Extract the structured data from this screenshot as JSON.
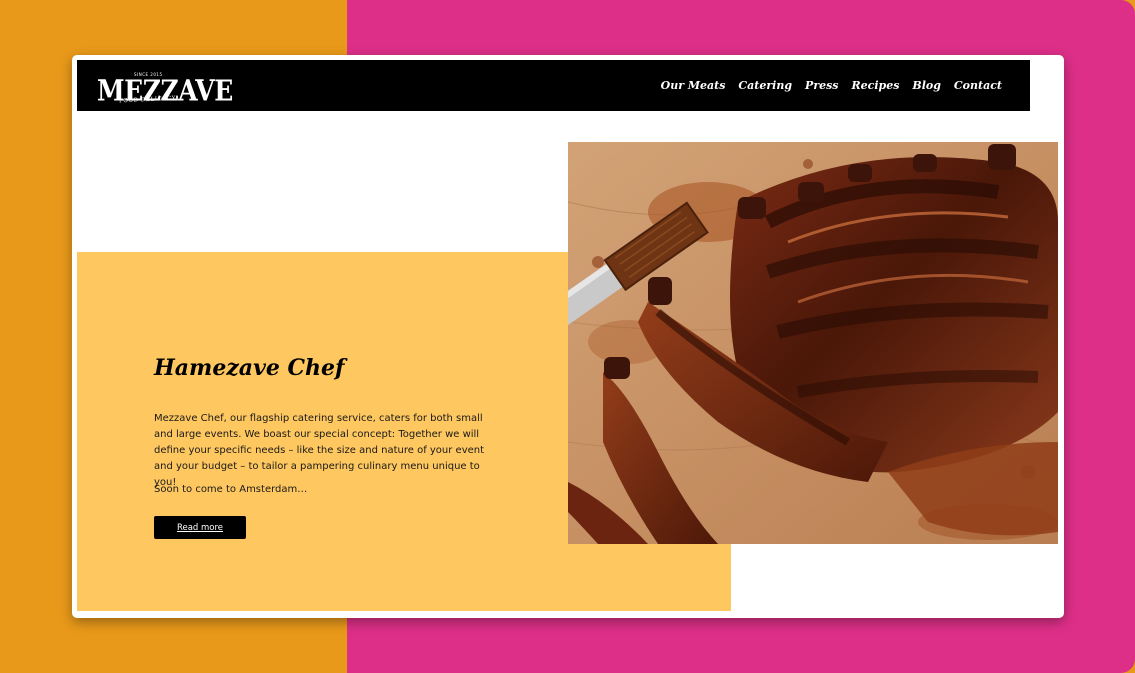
{
  "brand": {
    "tagline": "SINCE 2015",
    "name": "MEZZAVE",
    "subtitle": "FOOD DELICACY"
  },
  "nav": {
    "items": [
      {
        "label": "Our Meats"
      },
      {
        "label": "Catering"
      },
      {
        "label": "Press"
      },
      {
        "label": "Recipes"
      },
      {
        "label": "Blog"
      },
      {
        "label": "Contact"
      }
    ]
  },
  "hero": {
    "heading": "Hamezave Chef",
    "body": "Mezzave Chef, our flagship catering service, caters for both small and large events. We boast our special concept: Together we will define your specific needs – like the size and nature of your event and your budget – to tailor a pampering culinary menu unique to you!",
    "soon": "Soon to come to Amsterdam…",
    "cta_label": "Read more"
  },
  "colors": {
    "background_left": "#e8991a",
    "background_right": "#dd2f88",
    "navbar": "#000000",
    "panel": "#fec75f",
    "button": "#000000"
  }
}
